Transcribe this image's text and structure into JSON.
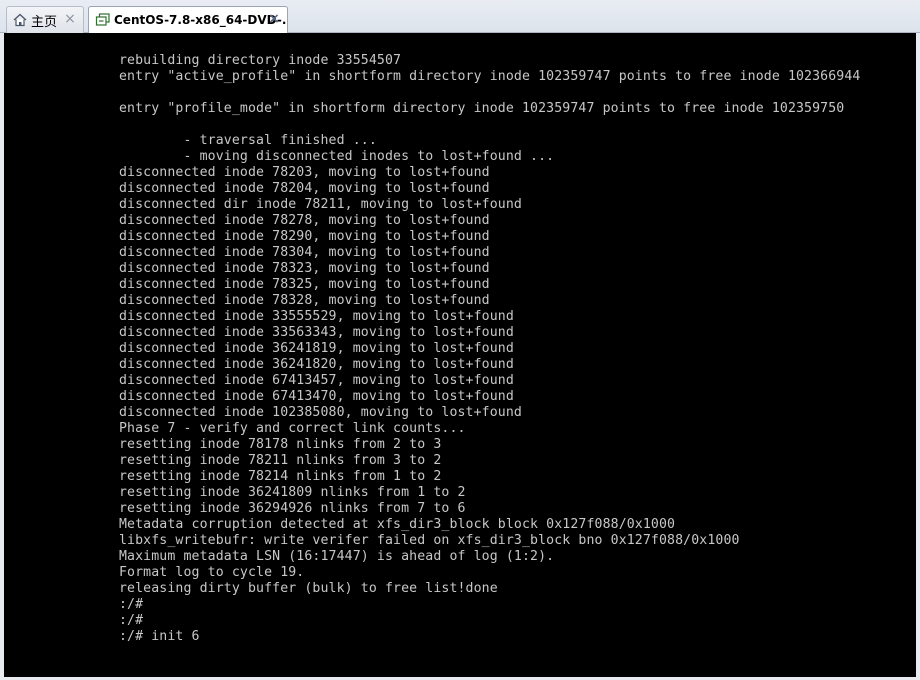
{
  "tabs": [
    {
      "label": "主页",
      "icon": "home-icon",
      "active": false
    },
    {
      "label": "CentOS-7.8-x86_64-DVD-...",
      "icon": "vm-icon",
      "active": true
    }
  ],
  "close_glyph": "×",
  "console": {
    "background": "#000000",
    "text_color": "#c7c7c7",
    "lines": [
      "rebuilding directory inode 33554507",
      "entry \"active_profile\" in shortform directory inode 102359747 points to free inode 102366944",
      "",
      "entry \"profile_mode\" in shortform directory inode 102359747 points to free inode 102359750",
      "",
      "        - traversal finished ...",
      "        - moving disconnected inodes to lost+found ...",
      "disconnected inode 78203, moving to lost+found",
      "disconnected inode 78204, moving to lost+found",
      "disconnected dir inode 78211, moving to lost+found",
      "disconnected inode 78278, moving to lost+found",
      "disconnected inode 78290, moving to lost+found",
      "disconnected inode 78304, moving to lost+found",
      "disconnected inode 78323, moving to lost+found",
      "disconnected inode 78325, moving to lost+found",
      "disconnected inode 78328, moving to lost+found",
      "disconnected inode 33555529, moving to lost+found",
      "disconnected inode 33563343, moving to lost+found",
      "disconnected inode 36241819, moving to lost+found",
      "disconnected inode 36241820, moving to lost+found",
      "disconnected inode 67413457, moving to lost+found",
      "disconnected inode 67413470, moving to lost+found",
      "disconnected inode 102385080, moving to lost+found",
      "Phase 7 - verify and correct link counts...",
      "resetting inode 78178 nlinks from 2 to 3",
      "resetting inode 78211 nlinks from 3 to 2",
      "resetting inode 78214 nlinks from 1 to 2",
      "resetting inode 36241809 nlinks from 1 to 2",
      "resetting inode 36294926 nlinks from 7 to 6",
      "Metadata corruption detected at xfs_dir3_block block 0x127f088/0x1000",
      "libxfs_writebufr: write verifer failed on xfs_dir3_block bno 0x127f088/0x1000",
      "Maximum metadata LSN (16:17447) is ahead of log (1:2).",
      "Format log to cycle 19.",
      "releasing dirty buffer (bulk) to free list!done",
      ":/#",
      ":/#",
      ":/# init 6"
    ]
  }
}
